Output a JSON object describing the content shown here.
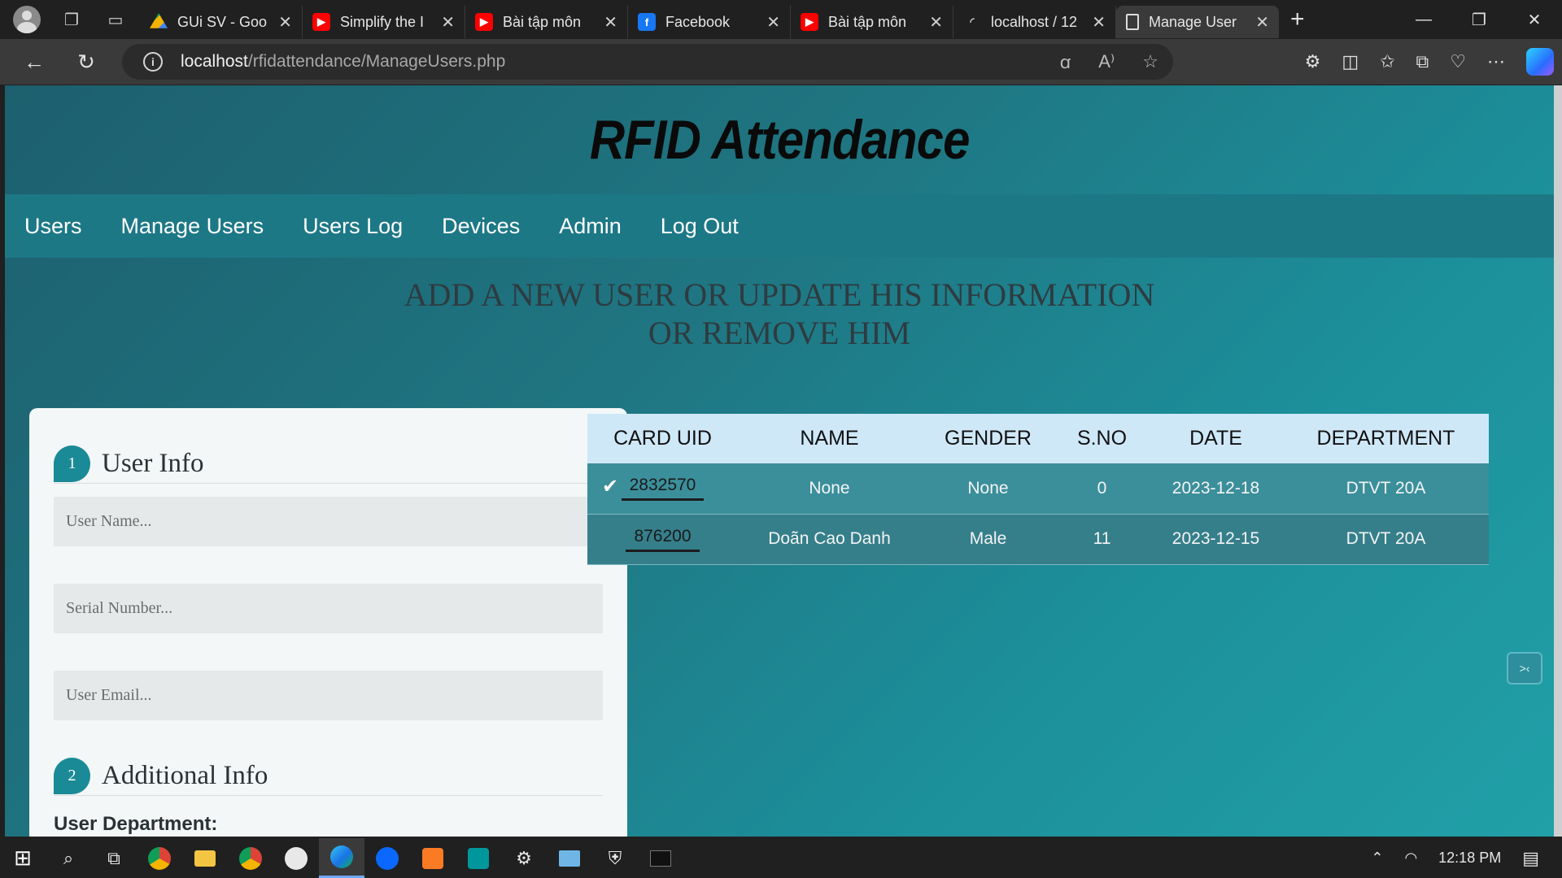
{
  "browser": {
    "tabs": [
      {
        "label": "GUi SV - Goo",
        "favicon": "google-drive-icon"
      },
      {
        "label": "Simplify the I",
        "favicon": "youtube-icon"
      },
      {
        "label": "Bài tập môn",
        "favicon": "youtube-icon"
      },
      {
        "label": "Facebook",
        "favicon": "facebook-icon"
      },
      {
        "label": "Bài tập môn",
        "favicon": "youtube-icon"
      },
      {
        "label": "localhost / 12",
        "favicon": "loading-icon"
      },
      {
        "label": "Manage User",
        "favicon": "page-icon"
      }
    ],
    "url_host": "localhost",
    "url_path": "/rfidattendance/ManageUsers.php"
  },
  "page": {
    "brand": "RFID Attendance",
    "nav": [
      "Users",
      "Manage Users",
      "Users Log",
      "Devices",
      "Admin",
      "Log Out"
    ],
    "heading_line1": "ADD A NEW USER OR UPDATE HIS INFORMATION",
    "heading_line2": "OR REMOVE HIM"
  },
  "form": {
    "section1_num": "1",
    "section1_title": "User Info",
    "username_placeholder": "User Name...",
    "serial_placeholder": "Serial Number...",
    "email_placeholder": "User Email...",
    "section2_num": "2",
    "section2_title": "Additional Info",
    "department_label": "User Department:"
  },
  "table": {
    "headers": [
      "CARD UID",
      "NAME",
      "GENDER",
      "S.NO",
      "DATE",
      "DEPARTMENT"
    ],
    "rows": [
      {
        "uid": "2832570",
        "name": "None",
        "gender": "None",
        "sno": "0",
        "date": "2023-12-18",
        "dept": "DTVT 20A",
        "selected": true
      },
      {
        "uid": "876200",
        "name": "Doãn Cao Danh",
        "gender": "Male",
        "sno": "11",
        "date": "2023-12-15",
        "dept": "DTVT 20A",
        "selected": false
      }
    ]
  },
  "taskbar": {
    "time": "12:18 PM"
  },
  "colors": {
    "accent": "#1a8a96",
    "nav_bg": "#1d7886",
    "table_header": "#cfe8f8"
  }
}
